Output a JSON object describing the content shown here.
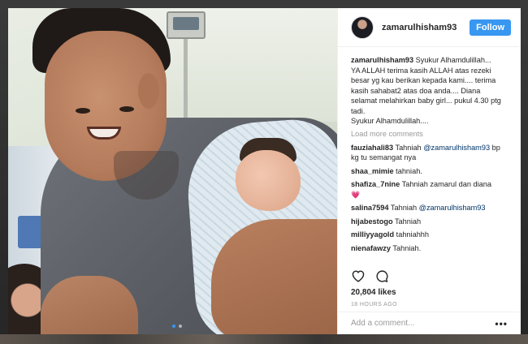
{
  "post": {
    "username": "zamarulhisham93",
    "follow_label": "Follow",
    "caption_user": "zamarulhisham93",
    "caption_text": " Syukur Alhamdulillah...\nYA ALLAH terima kasih ALLAH atas rezeki besar yg kau berikan kepada kami.... terima kasih sahabat2 atas doa anda.... Diana selamat melahirkan baby girl... pukul 4.30 ptg tadi.\nSyukur Alhamdulillah....",
    "load_more": "Load more comments",
    "comments": [
      {
        "user": "fauziahali83",
        "pre": " Tahniah ",
        "mention": "@zamarulhisham93",
        "post": " bp kg tu semangat nya"
      },
      {
        "user": "shaa_mimie",
        "pre": " tahniah.",
        "mention": "",
        "post": ""
      },
      {
        "user": "shafiza_7nine",
        "pre": " Tahniah zamarul dan diana ",
        "mention": "",
        "post": "💗"
      },
      {
        "user": "salina7594",
        "pre": " Tahniah ",
        "mention": "@zamarulhisham93",
        "post": ""
      },
      {
        "user": "hijabestogo",
        "pre": " Tahniah",
        "mention": "",
        "post": ""
      },
      {
        "user": "milliyyagold",
        "pre": " tahniahhh",
        "mention": "",
        "post": ""
      },
      {
        "user": "nienafawzy",
        "pre": " Tahniah.",
        "mention": "",
        "post": ""
      }
    ],
    "likes": "20,804 likes",
    "time": "18 HOURS AGO",
    "add_comment_placeholder": "Add a comment...",
    "more_label": "•••"
  },
  "icons": {
    "like": "heart-icon",
    "comment": "comment-bubble-icon",
    "more": "ellipsis-icon"
  },
  "colors": {
    "accent": "#3897f0",
    "mention": "#003569",
    "muted": "#999999"
  }
}
